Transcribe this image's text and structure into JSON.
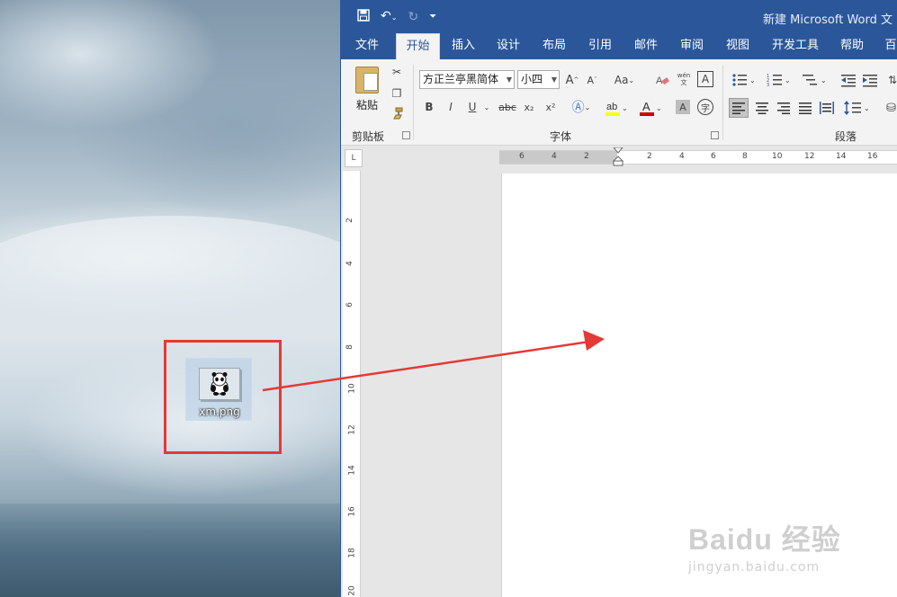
{
  "desktop": {
    "file_icon": {
      "name": "xm.png",
      "icon": "panda-thumbnail-icon"
    }
  },
  "word": {
    "title": "新建 Microsoft Word 文",
    "qat": {
      "save_icon": "save-icon",
      "undo_icon": "undo-icon",
      "redo_icon": "redo-icon",
      "customize_icon": "customize-icon"
    },
    "tabs": [
      "文件",
      "开始",
      "插入",
      "设计",
      "布局",
      "引用",
      "邮件",
      "审阅",
      "视图",
      "开发工具",
      "帮助",
      "百"
    ],
    "active_tab": "开始",
    "clipboard": {
      "paste_label": "粘贴",
      "group_label": "剪贴板"
    },
    "font": {
      "family": "方正兰亭黑简体",
      "size": "小四",
      "group_label": "字体",
      "case_label": "Aa",
      "phonetic_label": "wén",
      "buttons": [
        "B",
        "I",
        "U",
        "abc",
        "x₂",
        "x²"
      ]
    },
    "paragraph": {
      "group_label": "段落"
    },
    "ruler": {
      "corner": "L",
      "h_numbers": [
        "6",
        "4",
        "2",
        "2",
        "4",
        "6",
        "8",
        "10",
        "12",
        "14",
        "16"
      ],
      "v_numbers": [
        "2",
        "4",
        "6",
        "8",
        "10",
        "12",
        "14",
        "16",
        "18",
        "20"
      ]
    }
  },
  "watermark": {
    "brand": "Baidu 经验",
    "url": "jingyan.baidu.com"
  },
  "colors": {
    "word_blue": "#2b579a",
    "highlight_red": "#e53935",
    "font_color_red": "#d00000",
    "highlight_yellow": "#ffff00"
  }
}
